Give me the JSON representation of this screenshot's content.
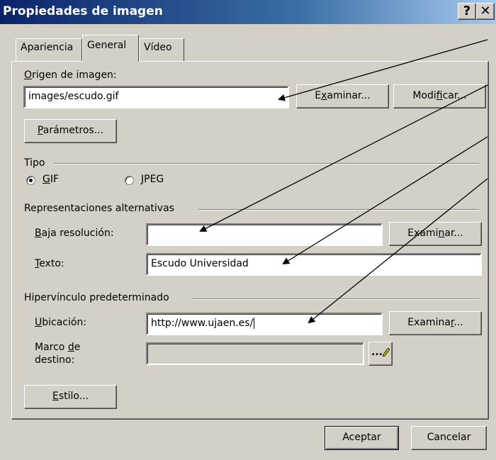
{
  "window": {
    "title": "Propiedades de imagen",
    "help_button": "?",
    "close_button": "✕"
  },
  "tabs": [
    {
      "label": "Apariencia",
      "active": false
    },
    {
      "label": "General",
      "active": true
    },
    {
      "label": "Vídeo",
      "active": false
    }
  ],
  "origen": {
    "label_first": "O",
    "label_rest": "rigen de imagen:",
    "value": "images/escudo.gif",
    "examinar": {
      "pre": "E",
      "u": "x",
      "post": "aminar..."
    },
    "modificar": {
      "pre": "Modi",
      "u": "f",
      "post": "icar..."
    },
    "parametros": {
      "u": "P",
      "post": "arámetros..."
    }
  },
  "tipo": {
    "label": "Tipo",
    "gif": {
      "u": "G",
      "post": "IF",
      "checked": true
    },
    "jpeg": {
      "u": "J",
      "post": "PEG",
      "checked": false
    }
  },
  "alternativas": {
    "label": "Representaciones alternativas",
    "baja": {
      "u": "B",
      "post": "aja resolución:",
      "value": ""
    },
    "baja_examinar": {
      "pre": "Exami",
      "u": "n",
      "post": "ar..."
    },
    "texto": {
      "u": "T",
      "post": "exto:",
      "value": "Escudo Universidad"
    }
  },
  "hipervinculo": {
    "label": "Hipervínculo predeterminado",
    "ubicacion": {
      "u": "U",
      "post": "bicación:",
      "value": "http://www.ujaen.es/"
    },
    "ubicacion_examinar": {
      "pre": "Examina",
      "u": "r",
      "post": "..."
    },
    "marco": {
      "line1_pre": "Marco ",
      "u": "d",
      "line1_post": "e",
      "line2": "destino:",
      "value": ""
    },
    "marco_button": "..."
  },
  "estilo": {
    "u": "E",
    "post": "stilo..."
  },
  "footer": {
    "aceptar": "Aceptar",
    "cancelar": "Cancelar"
  }
}
